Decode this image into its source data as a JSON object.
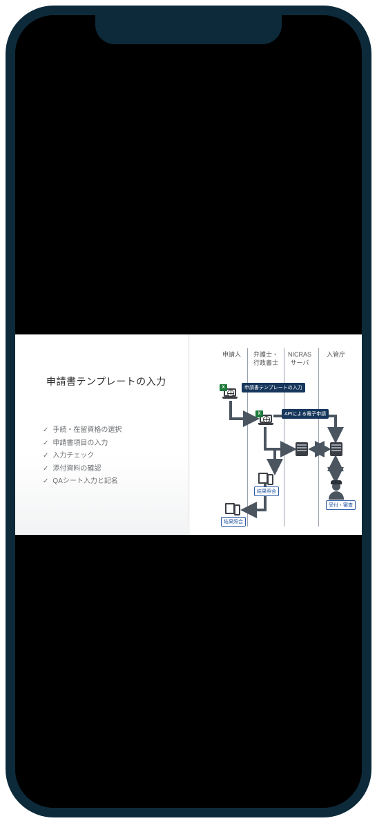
{
  "slide": {
    "title": "申請書テンプレートの入力",
    "checklist": [
      "手続・在留資格の選択",
      "申請書項目の入力",
      "入力チェック",
      "添付資料の確認",
      "QAシート入力と記名"
    ]
  },
  "diagram": {
    "columns": {
      "c1": "申請人",
      "c2": "弁護士・\n行政書士",
      "c3": "NICRAS\nサーバ",
      "c4": "入管庁"
    },
    "tags": {
      "template_input": "申請書テンプレートの入力",
      "api_submit": "APIによる電子申請",
      "result_inq_lawyer": "結果照会",
      "result_inq_applicant": "結果照会",
      "review": "受付・審査"
    },
    "badges": {
      "xls": "X"
    }
  }
}
